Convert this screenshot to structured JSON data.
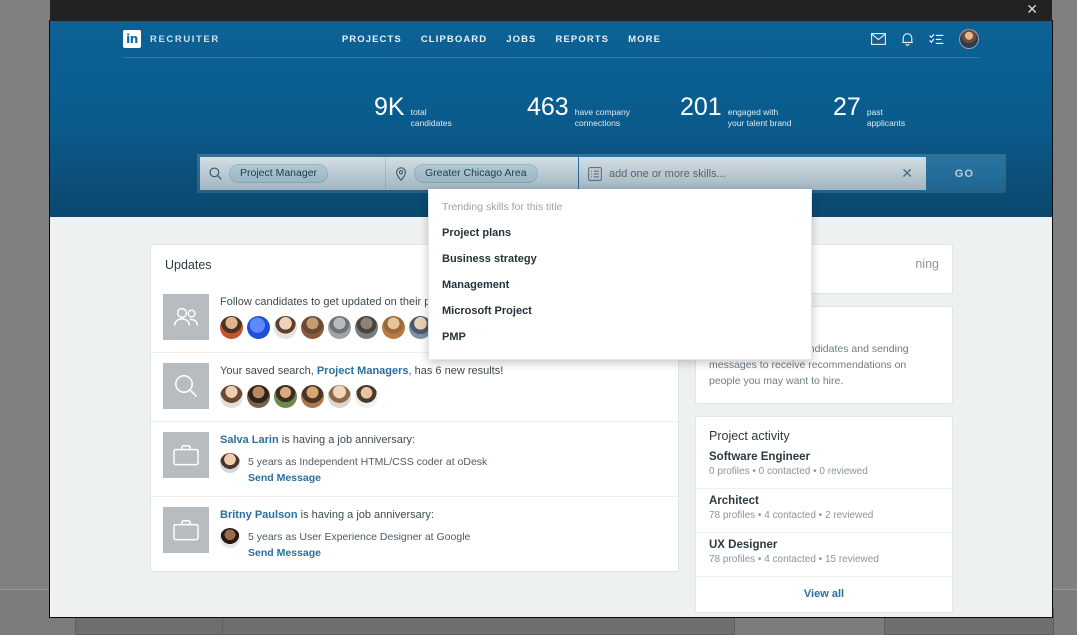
{
  "window": {
    "close_label": "✕"
  },
  "header": {
    "brand": "RECRUITER",
    "logo_text": "in",
    "nav": [
      {
        "label": "PROJECTS"
      },
      {
        "label": "CLIPBOARD"
      },
      {
        "label": "JOBS"
      },
      {
        "label": "REPORTS"
      },
      {
        "label": "MORE"
      }
    ],
    "icons": [
      {
        "name": "messages-icon"
      },
      {
        "name": "notifications-icon"
      },
      {
        "name": "tasks-icon"
      }
    ]
  },
  "stats": [
    {
      "number": "9K",
      "line1": "total",
      "line2": "candidates"
    },
    {
      "number": "463",
      "line1": "have company",
      "line2": "connections"
    },
    {
      "number": "201",
      "line1": "engaged with",
      "line2": "your talent brand"
    },
    {
      "number": "27",
      "line1": "past",
      "line2": "applicants"
    }
  ],
  "search": {
    "keywords_tag": "Project Manager",
    "location_tag": "Greater Chicago Area",
    "skills_value": "",
    "skills_placeholder": "add one or more skills...",
    "clear_label": "✕",
    "go_label": "GO"
  },
  "dropdown": {
    "heading": "Trending skills for this title",
    "items": [
      {
        "label": "Project plans"
      },
      {
        "label": "Business strategy"
      },
      {
        "label": "Management"
      },
      {
        "label": "Microsoft Project"
      },
      {
        "label": "PMP"
      }
    ]
  },
  "updates": {
    "title": "Updates",
    "follow": {
      "text_before": "Follow candidates to get updated on their profile changes. Some people",
      "avatars": [
        "#c97a4e",
        "#1f4fd8",
        "#cfa98a",
        "#8a5a3a",
        "#8e9296",
        "#5b6066",
        "#b67b43",
        "#7d8fa6",
        "#b9c2a8"
      ]
    },
    "saved_search": {
      "text_before": "Your saved search, ",
      "link": "Project Managers",
      "text_after": ", has 6 new results!",
      "avatars": [
        "#d7a78c",
        "#7a5338",
        "#6d8a4a",
        "#a9784f",
        "#d9b59a",
        "#c2a58c"
      ]
    },
    "anniversaries": [
      {
        "name": "Salva Larin",
        "suffix": " is having a job anniversary:",
        "detail": "5 years as Independent HTML/CSS coder at oDesk",
        "action": "Send Message",
        "avatar": "#e0b48e"
      },
      {
        "name": "Britny Paulson",
        "suffix": " is having a job anniversary:",
        "detail": "5 years as User Experience Designer at Google",
        "action": "Send Message",
        "avatar": "#6f4b36"
      }
    ]
  },
  "right": {
    "top_card_text": "ning",
    "recommend": {
      "text": "Start searching for candidates and sending messages to receive recommendations on people you may want to hire."
    },
    "project_activity": {
      "title": "Project activity",
      "items": [
        {
          "name": "Software Engineer",
          "meta": "0 profiles  •  0 contacted  •  0 reviewed"
        },
        {
          "name": "Architect",
          "meta": "78 profiles  •  4 contacted  •  2 reviewed"
        },
        {
          "name": "UX Designer",
          "meta": "78 profiles  •  4 contacted  •  15 reviewed"
        }
      ],
      "view_all": "View all"
    }
  }
}
